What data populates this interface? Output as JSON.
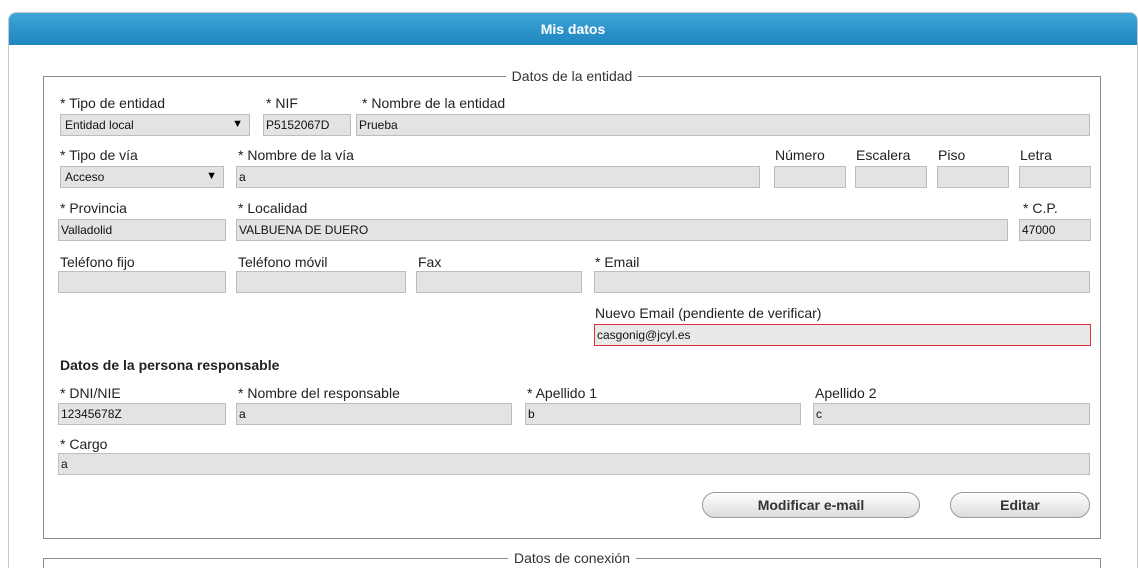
{
  "header": {
    "title": "Mis datos"
  },
  "entidad": {
    "legend": "Datos de la entidad",
    "tipo_entidad": {
      "label": "* Tipo de entidad",
      "value": "Entidad local"
    },
    "nif": {
      "label": "* NIF",
      "value": "P5152067D"
    },
    "nombre_entidad": {
      "label": "* Nombre de la entidad",
      "value": "Prueba"
    },
    "tipo_via": {
      "label": "* Tipo de vía",
      "value": "Acceso"
    },
    "nombre_via": {
      "label": "* Nombre de la vía",
      "value": "a"
    },
    "numero": {
      "label": "Número",
      "value": ""
    },
    "escalera": {
      "label": "Escalera",
      "value": ""
    },
    "piso": {
      "label": "Piso",
      "value": ""
    },
    "letra": {
      "label": "Letra",
      "value": ""
    },
    "provincia": {
      "label": "* Provincia",
      "value": "Valladolid"
    },
    "localidad": {
      "label": "* Localidad",
      "value": "VALBUENA DE DUERO"
    },
    "cp": {
      "label": "* C.P.",
      "value": "47000"
    },
    "telefono_fijo": {
      "label": "Teléfono fijo",
      "value": ""
    },
    "telefono_movil": {
      "label": "Teléfono móvil",
      "value": ""
    },
    "fax": {
      "label": "Fax",
      "value": ""
    },
    "email": {
      "label": "* Email",
      "value": ""
    },
    "nuevo_email": {
      "label": "Nuevo Email (pendiente de verificar)",
      "value": "casgonig@jcyl.es"
    }
  },
  "responsable": {
    "title": "Datos de la persona responsable",
    "dni": {
      "label": "* DNI/NIE",
      "value": "12345678Z"
    },
    "nombre": {
      "label": "* Nombre del responsable",
      "value": "a"
    },
    "apellido1": {
      "label": "* Apellido 1",
      "value": "b"
    },
    "apellido2": {
      "label": "Apellido 2",
      "value": "c"
    },
    "cargo": {
      "label": "* Cargo",
      "value": "a"
    }
  },
  "buttons": {
    "modificar_email": "Modificar e-mail",
    "editar": "Editar"
  },
  "conexion": {
    "legend": "Datos de conexión"
  },
  "colors": {
    "header": "#1f86bf",
    "alert_border": "#e0303a"
  }
}
